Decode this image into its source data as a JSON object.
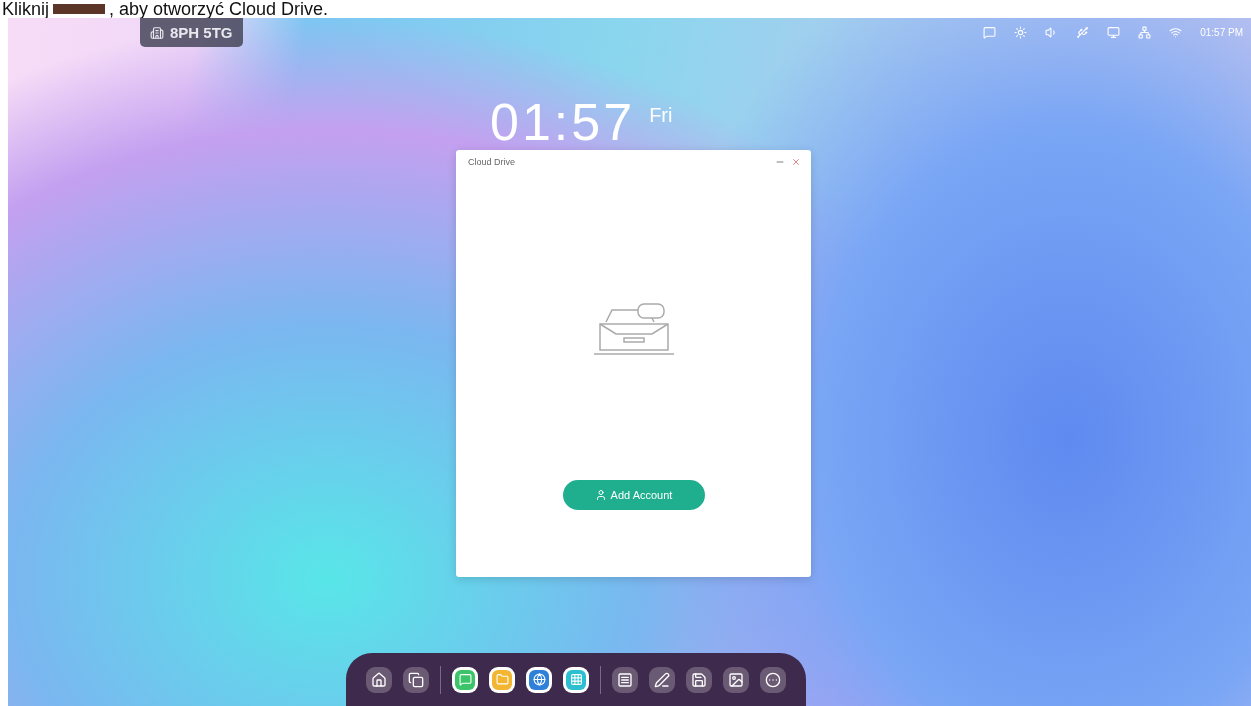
{
  "caption": {
    "before": "Kliknij",
    "after": ", aby otworzyć Cloud Drive."
  },
  "room_badge": {
    "label": "8PH 5TG"
  },
  "status_bar": {
    "time": "01:57 PM"
  },
  "clock": {
    "time": "01:57",
    "day": "Fri"
  },
  "window": {
    "title": "Cloud Drive",
    "button": "Add Account"
  },
  "dock": [
    {
      "kind": "system"
    },
    {
      "kind": "system"
    },
    {
      "kind": "separator"
    },
    {
      "kind": "app",
      "color": "#3cc46a"
    },
    {
      "kind": "app",
      "color": "#f2b632"
    },
    {
      "kind": "app",
      "color": "#2f80d8"
    },
    {
      "kind": "app",
      "color": "#2bbfd0"
    },
    {
      "kind": "separator"
    },
    {
      "kind": "system"
    },
    {
      "kind": "system"
    },
    {
      "kind": "system"
    },
    {
      "kind": "system"
    },
    {
      "kind": "system"
    }
  ]
}
